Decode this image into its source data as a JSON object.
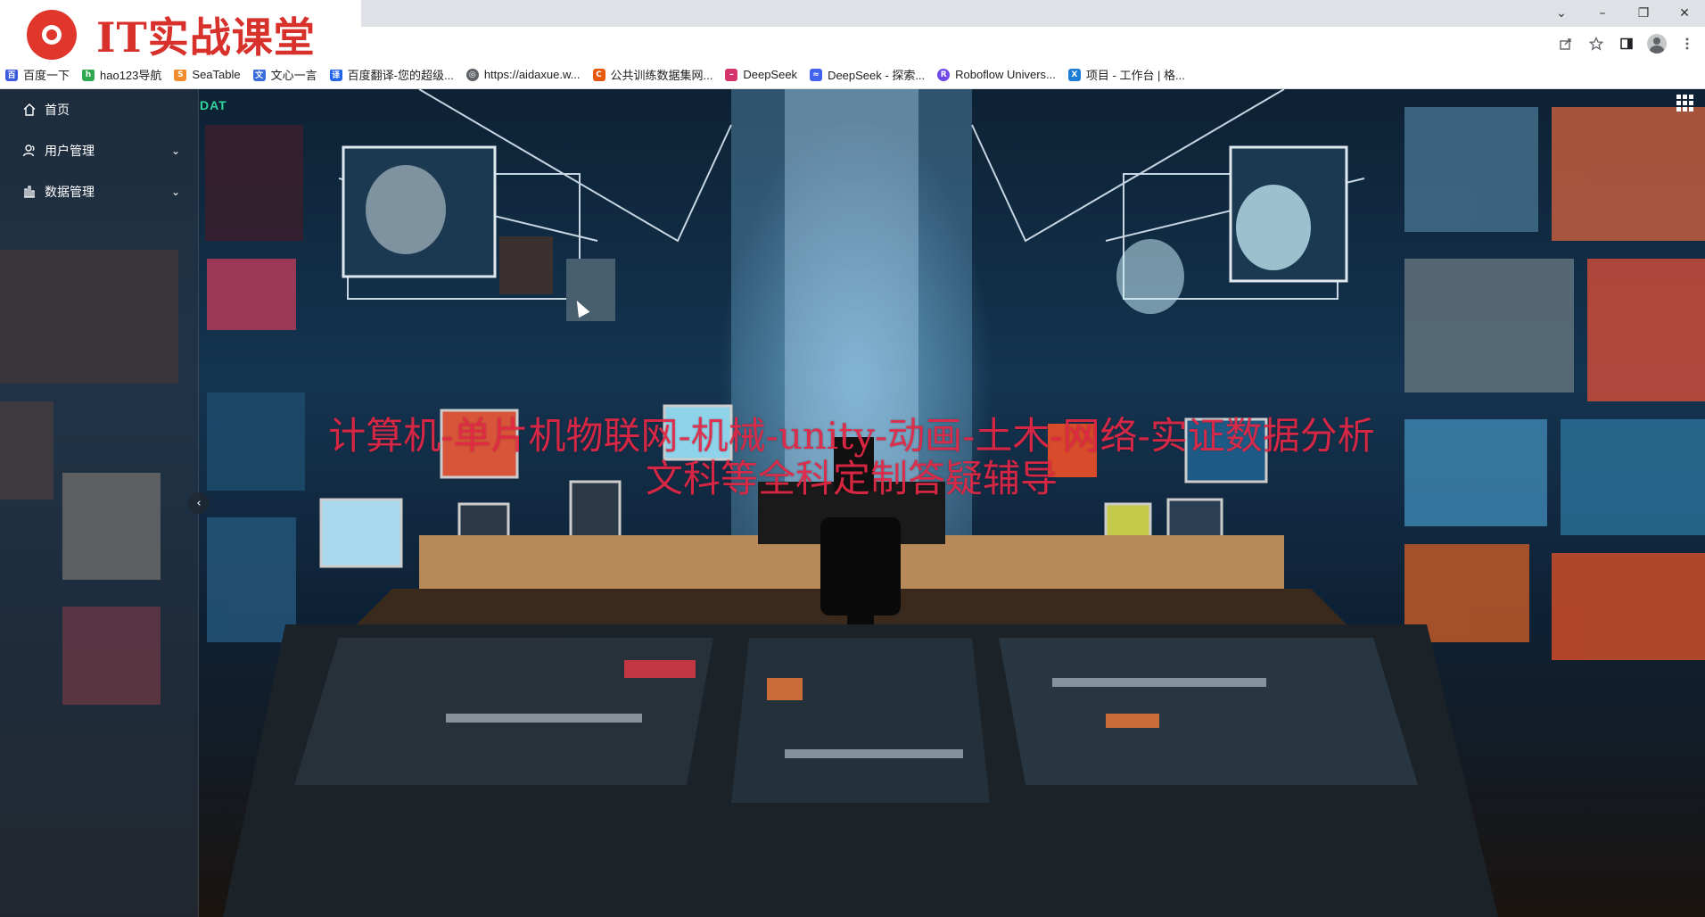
{
  "browser": {
    "window_controls": [
      "⌄",
      "–",
      "❐",
      "✕"
    ],
    "toolbar_icons": [
      "share-icon",
      "star-icon",
      "sidepanel-icon",
      "profile-icon",
      "more-icon"
    ],
    "bookmarks": [
      {
        "label": "百度一下",
        "icon": "baidu-icon",
        "color": "#3b5bdb"
      },
      {
        "label": "hao123导航",
        "icon": "hao123-icon",
        "color": "#2fa84f"
      },
      {
        "label": "SeaTable",
        "icon": "seatable-icon",
        "color": "#f08c2b"
      },
      {
        "label": "文心一言",
        "icon": "wenxin-icon",
        "color": "#3b6cdb"
      },
      {
        "label": "百度翻译-您的超级...",
        "icon": "baidu-translate-icon",
        "color": "#2463eb"
      },
      {
        "label": "https://aidaxue.w...",
        "icon": "globe-icon",
        "color": "#5f6368"
      },
      {
        "label": "公共训练数据集网...",
        "icon": "dataset-icon",
        "color": "#e8590c"
      },
      {
        "label": "DeepSeek",
        "icon": "deepseek-icon",
        "color": "#d6336c"
      },
      {
        "label": "DeepSeek - 探索...",
        "icon": "deepseek-whale-icon",
        "color": "#4263eb"
      },
      {
        "label": "Roboflow Univers...",
        "icon": "roboflow-icon",
        "color": "#7048e8"
      },
      {
        "label": "项目 - 工作台 | 格...",
        "icon": "x-icon",
        "color": "#1c7ed6"
      }
    ]
  },
  "logo": {
    "text": "IT实战课堂"
  },
  "header": {
    "tag": "DAT"
  },
  "sidebar": {
    "items": [
      {
        "label": "首页",
        "icon": "home-icon",
        "has_arrow": false
      },
      {
        "label": "用户管理",
        "icon": "user-icon",
        "has_arrow": true
      },
      {
        "label": "数据管理",
        "icon": "chart-bars-icon",
        "has_arrow": true
      }
    ],
    "collapse_label": "‹"
  },
  "overlay": {
    "line1": "计算机-单片机物联网-机械-unity-动画-土木-网络-实证数据分析",
    "line2": "文科等全科定制答疑辅导",
    "color": "#e62846"
  }
}
